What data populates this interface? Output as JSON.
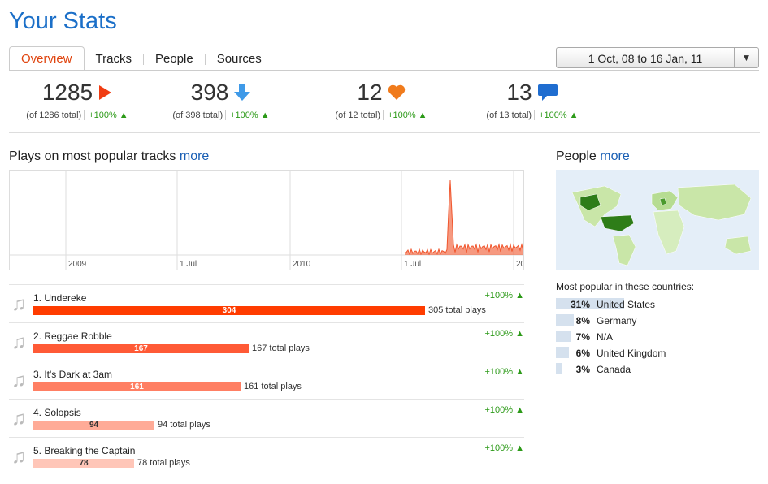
{
  "page": {
    "title": "Your Stats"
  },
  "tabs": [
    {
      "label": "Overview",
      "active": true
    },
    {
      "label": "Tracks",
      "active": false
    },
    {
      "label": "People",
      "active": false
    },
    {
      "label": "Sources",
      "active": false
    }
  ],
  "date_range": {
    "label": "1 Oct, 08 to 16 Jan, 11"
  },
  "stats": [
    {
      "value": "1285",
      "icon": "play-icon",
      "sub": "(of 1286 total)",
      "change": "+100% ▲"
    },
    {
      "value": "398",
      "icon": "download-icon",
      "sub": "(of 398 total)",
      "change": "+100% ▲"
    },
    {
      "value": "12",
      "icon": "heart-icon",
      "sub": "(of 12 total)",
      "change": "+100% ▲"
    },
    {
      "value": "13",
      "icon": "comment-icon",
      "sub": "(of 13 total)",
      "change": "+100% ▲"
    }
  ],
  "plays_section": {
    "title": "Plays on most popular tracks",
    "more": "more"
  },
  "chart_data": {
    "type": "line",
    "x_tick_labels": [
      "2009",
      "1 Jul",
      "2010",
      "1 Jul",
      "20"
    ],
    "color": "#f0552c"
  },
  "tracks": [
    {
      "rank_name": "1. Undereke",
      "plays": 304,
      "total": "305 total plays",
      "change": "+100% ▲",
      "color": "#ff3c00"
    },
    {
      "rank_name": "2. Reggae Robble",
      "plays": 167,
      "total": "167 total plays",
      "change": "+100% ▲",
      "color": "#ff5a36"
    },
    {
      "rank_name": "3. It's Dark at 3am",
      "plays": 161,
      "total": "161 total plays",
      "change": "+100% ▲",
      "color": "#ff7f63"
    },
    {
      "rank_name": "4. Solopsis",
      "plays": 94,
      "total": "94 total plays",
      "change": "+100% ▲",
      "color": "#ffab97"
    },
    {
      "rank_name": "5. Breaking the Captain",
      "plays": 78,
      "total": "78 total plays",
      "change": "+100% ▲",
      "color": "#ffc6b8"
    }
  ],
  "people_section": {
    "title": "People",
    "more": "more",
    "subtitle": "Most popular in these countries:"
  },
  "countries": [
    {
      "pct": "31%",
      "value": 31,
      "name": "United States"
    },
    {
      "pct": "8%",
      "value": 8,
      "name": "Germany"
    },
    {
      "pct": "7%",
      "value": 7,
      "name": "N/A"
    },
    {
      "pct": "6%",
      "value": 6,
      "name": "United Kingdom"
    },
    {
      "pct": "3%",
      "value": 3,
      "name": "Canada"
    }
  ],
  "colors": {
    "accent": "#1b6fc8",
    "tab_active": "#e0440e",
    "positive": "#2c9a18"
  }
}
